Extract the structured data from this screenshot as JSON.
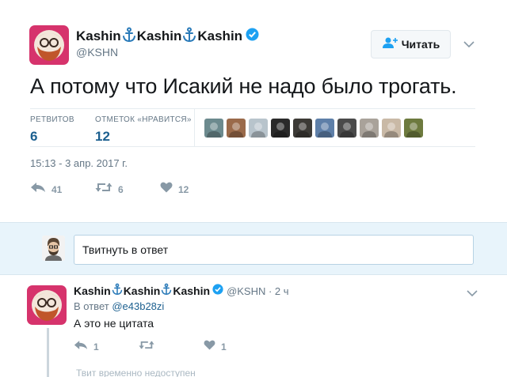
{
  "tweet": {
    "author_names": [
      "Kashin",
      "Kashin",
      "Kashin"
    ],
    "handle": "@KSHN",
    "follow_label": "Читать",
    "text": "А потому что Исакий не надо было трогать.",
    "retweets_label": "РЕТВИТОВ",
    "retweets_value": "6",
    "likes_label": "ОТМЕТОК «НРАВИТСЯ»",
    "likes_value": "12",
    "timestamp": "15:13 - 3 апр. 2017 г.",
    "reply_count": "41",
    "retweet_count": "6",
    "like_count": "12",
    "liker_avatar_colors": [
      "#6c8a8e",
      "#9a6a4a",
      "#b8c4cc",
      "#2a2a2a",
      "#3c3a36",
      "#5e7fa8",
      "#4a4a4a",
      "#a9a29a",
      "#c9b9a6",
      "#6d7a3e"
    ]
  },
  "reply_box": {
    "placeholder": "Твитнуть в ответ"
  },
  "reply": {
    "author_names": [
      "Kashin",
      "Kashin",
      "Kashin"
    ],
    "handle_time": "@KSHN · 2 ч",
    "reply_to_label": "В ответ",
    "reply_to_handle": "@e43b28zi",
    "text": "А это не цитата",
    "reply_count": "1",
    "like_count": "1",
    "unavailable_text": "Твит временно недоступен"
  },
  "colors": {
    "accent": "#1b5f8f",
    "anchor": "#2b7bb9",
    "verified": "#1da1f2",
    "avatar_bg": "#d6336c",
    "reply_bar_bg": "#e8f4fb",
    "muted": "#8899a6"
  },
  "icons": [
    "anchor-icon",
    "verified-icon",
    "follow-person-icon",
    "chevron-down-icon",
    "reply-icon",
    "retweet-icon",
    "heart-icon"
  ]
}
